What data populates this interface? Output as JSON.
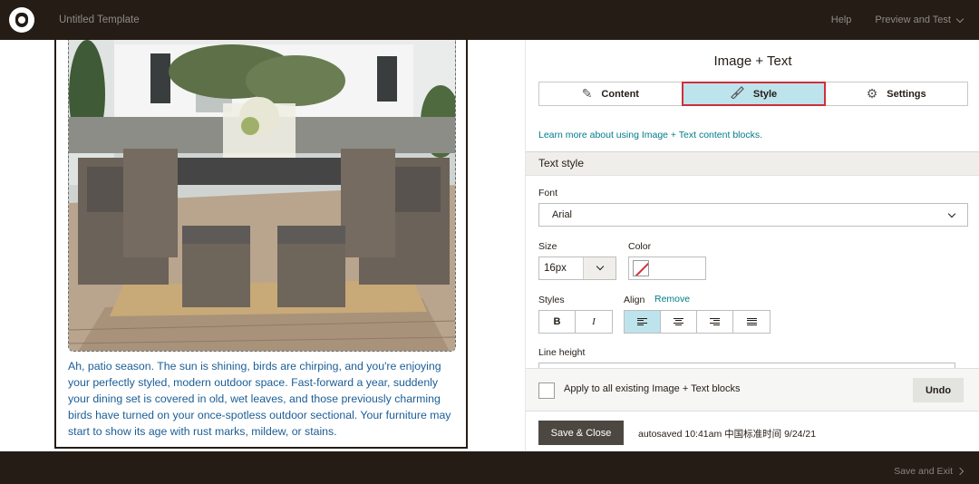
{
  "topbar": {
    "template_name": "Untitled Template",
    "help": "Help",
    "preview_test": "Preview and Test"
  },
  "preview": {
    "body_text": "Ah, patio season. The sun is shining, birds are chirping, and you're enjoying your perfectly styled, modern outdoor space. Fast-forward a year, suddenly your dining set is covered in old, wet leaves, and those previously charming birds have turned on your once-spotless outdoor sectional. Your furniture may start to show its age with rust marks, mildew, or stains."
  },
  "panel": {
    "title": "Image + Text",
    "tabs": [
      {
        "label": "Content",
        "icon": "pencil-icon",
        "active": false
      },
      {
        "label": "Style",
        "icon": "paintbrush-icon",
        "active": true
      },
      {
        "label": "Settings",
        "icon": "gear-icon",
        "active": false
      }
    ],
    "learn_link": "Learn more about using Image + Text content blocks.",
    "section_title": "Text style",
    "font": {
      "label": "Font",
      "value": "Arial"
    },
    "size": {
      "label": "Size",
      "value": "16px"
    },
    "color": {
      "label": "Color",
      "value": "none"
    },
    "styles": {
      "label": "Styles",
      "bold": "B",
      "italic": "I"
    },
    "align": {
      "label": "Align",
      "remove": "Remove",
      "selected": "left"
    },
    "line_height": {
      "label": "Line height"
    },
    "apply_all": "Apply to all existing Image + Text blocks",
    "undo": "Undo",
    "save_close": "Save & Close",
    "autosave": "autosaved 10:41am 中国标准时间 9/24/21"
  },
  "bottombar": {
    "save_exit": "Save and Exit"
  },
  "colors": {
    "topbar": "#241c15",
    "active_tab": "#bde3ec",
    "highlight_outline": "#d0303a",
    "link": "#007c89",
    "body_text": "#1a5d96"
  }
}
